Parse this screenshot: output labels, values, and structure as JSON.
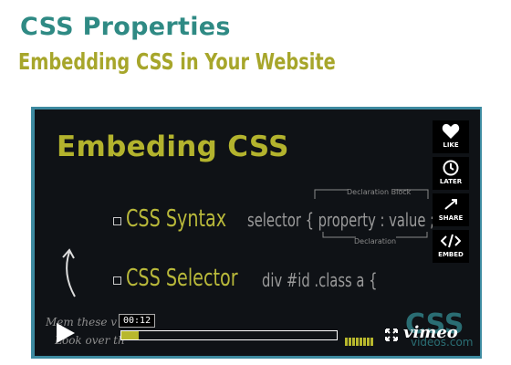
{
  "header": {
    "title": "CSS Properties",
    "subtitle": "Embedding CSS in Your Website"
  },
  "slide": {
    "title": "Embeding CSS",
    "items": [
      {
        "label": "CSS Syntax",
        "code": "selector { property : value ;"
      },
      {
        "label": "CSS Selector",
        "code": "div #id .class a {"
      }
    ],
    "declaration_block_label": "Declaration Block",
    "declaration_label": "Declaration",
    "handwritten_1": "Mem these v",
    "handwritten_2": "Look over th",
    "watermark": "CSS",
    "watermark_sub": "videos.com"
  },
  "sidebar": {
    "like": "LIKE",
    "later": "LATER",
    "share": "SHARE",
    "embed": "EMBED"
  },
  "controls": {
    "time_tooltip": "00:12",
    "progress_fraction": 0.08,
    "logo": "vimeo"
  },
  "colors": {
    "title_teal": "#2f8a84",
    "subtitle_olive": "#a7a62b",
    "slide_yellow": "#b3b32d",
    "frame_blue": "#3d8aa0"
  },
  "icons": {
    "like": "heart-icon",
    "later": "clock-icon",
    "share": "share-icon",
    "embed": "code-icon",
    "play": "play-icon",
    "fullscreen": "fullscreen-icon",
    "arrow": "curved-arrow-icon"
  }
}
